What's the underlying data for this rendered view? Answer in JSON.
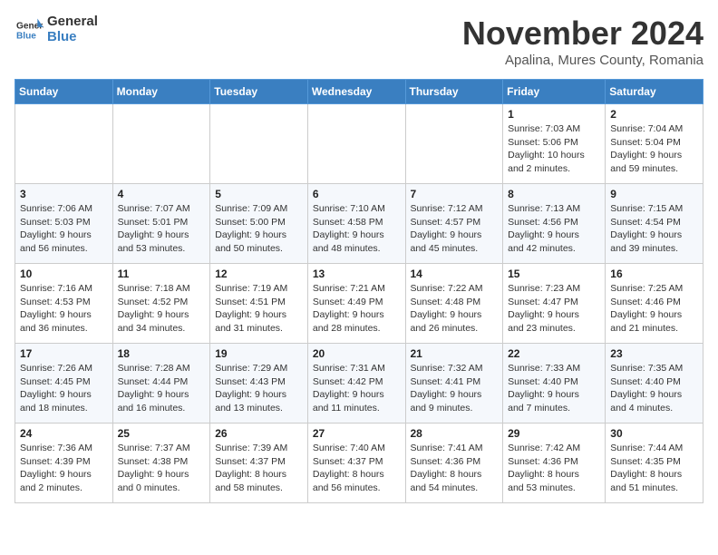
{
  "logo": {
    "line1": "General",
    "line2": "Blue"
  },
  "title": "November 2024",
  "subtitle": "Apalina, Mures County, Romania",
  "headers": [
    "Sunday",
    "Monday",
    "Tuesday",
    "Wednesday",
    "Thursday",
    "Friday",
    "Saturday"
  ],
  "weeks": [
    [
      {
        "day": "",
        "info": ""
      },
      {
        "day": "",
        "info": ""
      },
      {
        "day": "",
        "info": ""
      },
      {
        "day": "",
        "info": ""
      },
      {
        "day": "",
        "info": ""
      },
      {
        "day": "1",
        "info": "Sunrise: 7:03 AM\nSunset: 5:06 PM\nDaylight: 10 hours\nand 2 minutes."
      },
      {
        "day": "2",
        "info": "Sunrise: 7:04 AM\nSunset: 5:04 PM\nDaylight: 9 hours\nand 59 minutes."
      }
    ],
    [
      {
        "day": "3",
        "info": "Sunrise: 7:06 AM\nSunset: 5:03 PM\nDaylight: 9 hours\nand 56 minutes."
      },
      {
        "day": "4",
        "info": "Sunrise: 7:07 AM\nSunset: 5:01 PM\nDaylight: 9 hours\nand 53 minutes."
      },
      {
        "day": "5",
        "info": "Sunrise: 7:09 AM\nSunset: 5:00 PM\nDaylight: 9 hours\nand 50 minutes."
      },
      {
        "day": "6",
        "info": "Sunrise: 7:10 AM\nSunset: 4:58 PM\nDaylight: 9 hours\nand 48 minutes."
      },
      {
        "day": "7",
        "info": "Sunrise: 7:12 AM\nSunset: 4:57 PM\nDaylight: 9 hours\nand 45 minutes."
      },
      {
        "day": "8",
        "info": "Sunrise: 7:13 AM\nSunset: 4:56 PM\nDaylight: 9 hours\nand 42 minutes."
      },
      {
        "day": "9",
        "info": "Sunrise: 7:15 AM\nSunset: 4:54 PM\nDaylight: 9 hours\nand 39 minutes."
      }
    ],
    [
      {
        "day": "10",
        "info": "Sunrise: 7:16 AM\nSunset: 4:53 PM\nDaylight: 9 hours\nand 36 minutes."
      },
      {
        "day": "11",
        "info": "Sunrise: 7:18 AM\nSunset: 4:52 PM\nDaylight: 9 hours\nand 34 minutes."
      },
      {
        "day": "12",
        "info": "Sunrise: 7:19 AM\nSunset: 4:51 PM\nDaylight: 9 hours\nand 31 minutes."
      },
      {
        "day": "13",
        "info": "Sunrise: 7:21 AM\nSunset: 4:49 PM\nDaylight: 9 hours\nand 28 minutes."
      },
      {
        "day": "14",
        "info": "Sunrise: 7:22 AM\nSunset: 4:48 PM\nDaylight: 9 hours\nand 26 minutes."
      },
      {
        "day": "15",
        "info": "Sunrise: 7:23 AM\nSunset: 4:47 PM\nDaylight: 9 hours\nand 23 minutes."
      },
      {
        "day": "16",
        "info": "Sunrise: 7:25 AM\nSunset: 4:46 PM\nDaylight: 9 hours\nand 21 minutes."
      }
    ],
    [
      {
        "day": "17",
        "info": "Sunrise: 7:26 AM\nSunset: 4:45 PM\nDaylight: 9 hours\nand 18 minutes."
      },
      {
        "day": "18",
        "info": "Sunrise: 7:28 AM\nSunset: 4:44 PM\nDaylight: 9 hours\nand 16 minutes."
      },
      {
        "day": "19",
        "info": "Sunrise: 7:29 AM\nSunset: 4:43 PM\nDaylight: 9 hours\nand 13 minutes."
      },
      {
        "day": "20",
        "info": "Sunrise: 7:31 AM\nSunset: 4:42 PM\nDaylight: 9 hours\nand 11 minutes."
      },
      {
        "day": "21",
        "info": "Sunrise: 7:32 AM\nSunset: 4:41 PM\nDaylight: 9 hours\nand 9 minutes."
      },
      {
        "day": "22",
        "info": "Sunrise: 7:33 AM\nSunset: 4:40 PM\nDaylight: 9 hours\nand 7 minutes."
      },
      {
        "day": "23",
        "info": "Sunrise: 7:35 AM\nSunset: 4:40 PM\nDaylight: 9 hours\nand 4 minutes."
      }
    ],
    [
      {
        "day": "24",
        "info": "Sunrise: 7:36 AM\nSunset: 4:39 PM\nDaylight: 9 hours\nand 2 minutes."
      },
      {
        "day": "25",
        "info": "Sunrise: 7:37 AM\nSunset: 4:38 PM\nDaylight: 9 hours\nand 0 minutes."
      },
      {
        "day": "26",
        "info": "Sunrise: 7:39 AM\nSunset: 4:37 PM\nDaylight: 8 hours\nand 58 minutes."
      },
      {
        "day": "27",
        "info": "Sunrise: 7:40 AM\nSunset: 4:37 PM\nDaylight: 8 hours\nand 56 minutes."
      },
      {
        "day": "28",
        "info": "Sunrise: 7:41 AM\nSunset: 4:36 PM\nDaylight: 8 hours\nand 54 minutes."
      },
      {
        "day": "29",
        "info": "Sunrise: 7:42 AM\nSunset: 4:36 PM\nDaylight: 8 hours\nand 53 minutes."
      },
      {
        "day": "30",
        "info": "Sunrise: 7:44 AM\nSunset: 4:35 PM\nDaylight: 8 hours\nand 51 minutes."
      }
    ]
  ]
}
